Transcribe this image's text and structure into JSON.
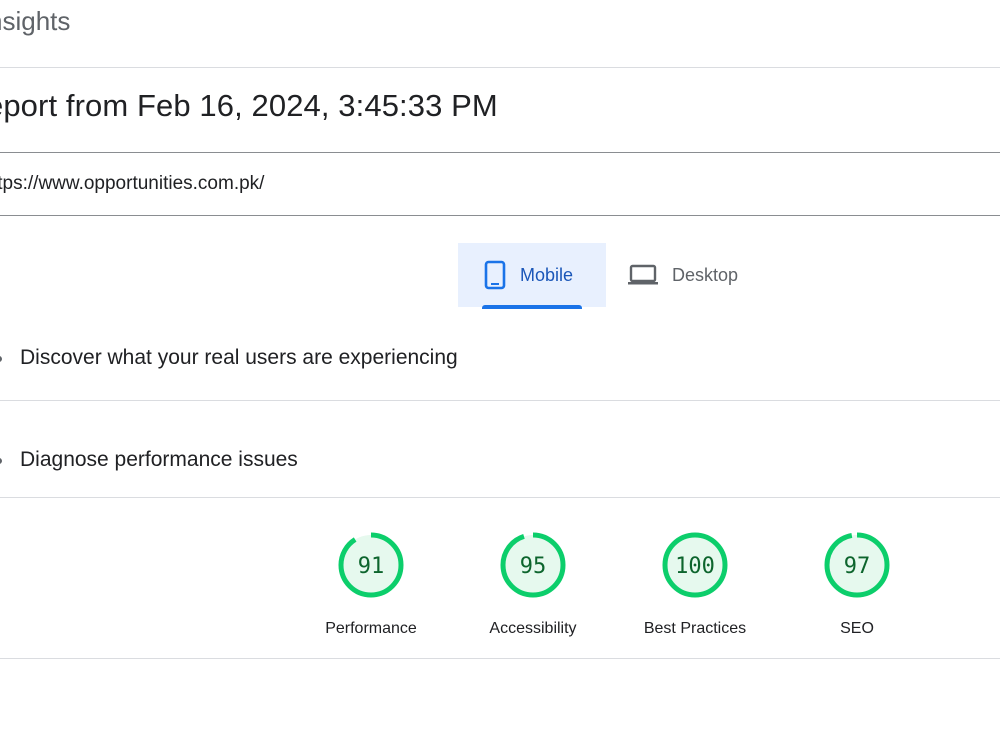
{
  "app": {
    "title": "nsights"
  },
  "report": {
    "title": "eport from Feb 16, 2024, 3:45:33 PM"
  },
  "url_field": {
    "value": "ttps://www.opportunities.com.pk/"
  },
  "tabs": [
    {
      "label": "Mobile",
      "icon": "smartphone-icon",
      "selected": true
    },
    {
      "label": "Desktop",
      "icon": "laptop-icon",
      "selected": false
    }
  ],
  "sections": {
    "field_data": {
      "heading": "Discover what your real users are experiencing"
    },
    "lab_data": {
      "heading": "Diagnose performance issues"
    }
  },
  "scores": [
    {
      "label": "Performance",
      "value": "91"
    },
    {
      "label": "Accessibility",
      "value": "95"
    },
    {
      "label": "Best Practices",
      "value": "100"
    },
    {
      "label": "SEO",
      "value": "97"
    }
  ],
  "colors": {
    "pass": "#0cce6b",
    "pass_text": "#0d652d",
    "accent": "#1a73e8",
    "tab_bg": "#e8f0fe"
  }
}
